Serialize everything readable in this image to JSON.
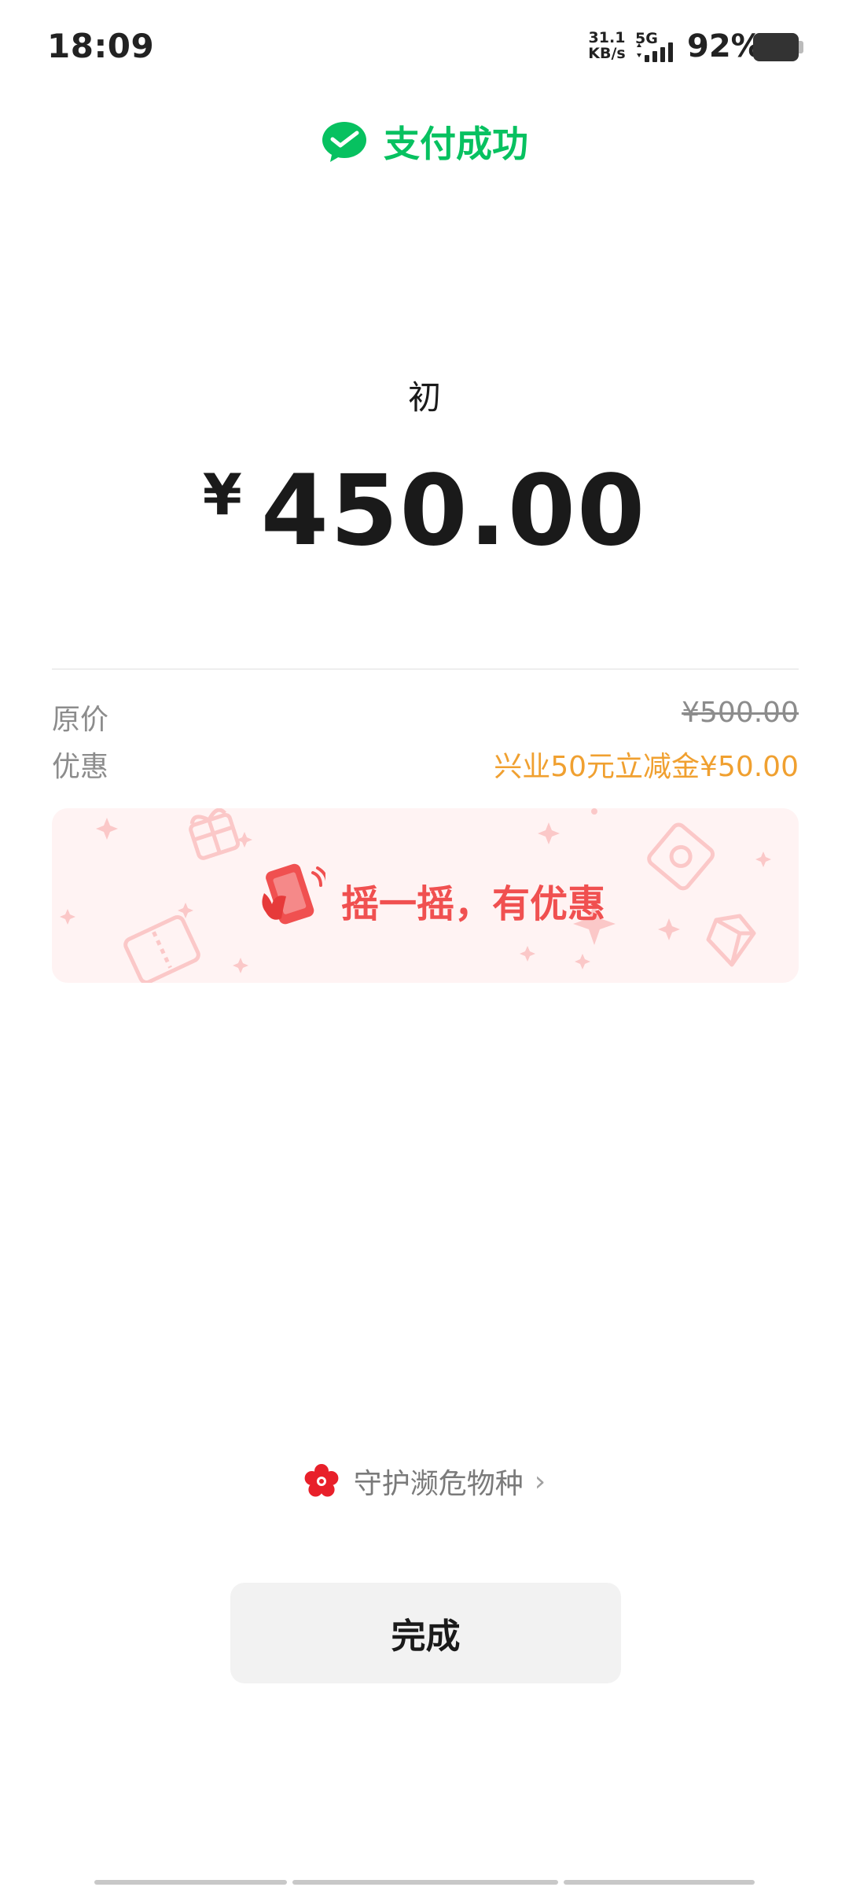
{
  "status_bar": {
    "time": "18:09",
    "net_speed_value": "31.1",
    "net_speed_unit": "KB/s",
    "network_type": "5G",
    "battery_percent": "92%",
    "battery_icon": "battery-icon",
    "signal_icon": "signal-icon"
  },
  "header": {
    "icon": "wechat-pay-icon",
    "title": "支付成功",
    "title_color": "#07c160"
  },
  "payment": {
    "merchant": "初",
    "currency_symbol": "¥",
    "amount": "450.00"
  },
  "details": {
    "original_price_label": "原价",
    "original_price_value": "¥500.00",
    "discount_label": "优惠",
    "discount_value": "兴业50元立减金¥50.00",
    "discount_color": "#f0a030"
  },
  "promo": {
    "icon": "shake-phone-icon",
    "text": "摇一摇，有优惠",
    "text_color": "#f05050",
    "background_color": "#fff3f3"
  },
  "species": {
    "icon": "red-flower-icon",
    "text": "守护濒危物种",
    "chevron": "›"
  },
  "actions": {
    "done_label": "完成"
  }
}
